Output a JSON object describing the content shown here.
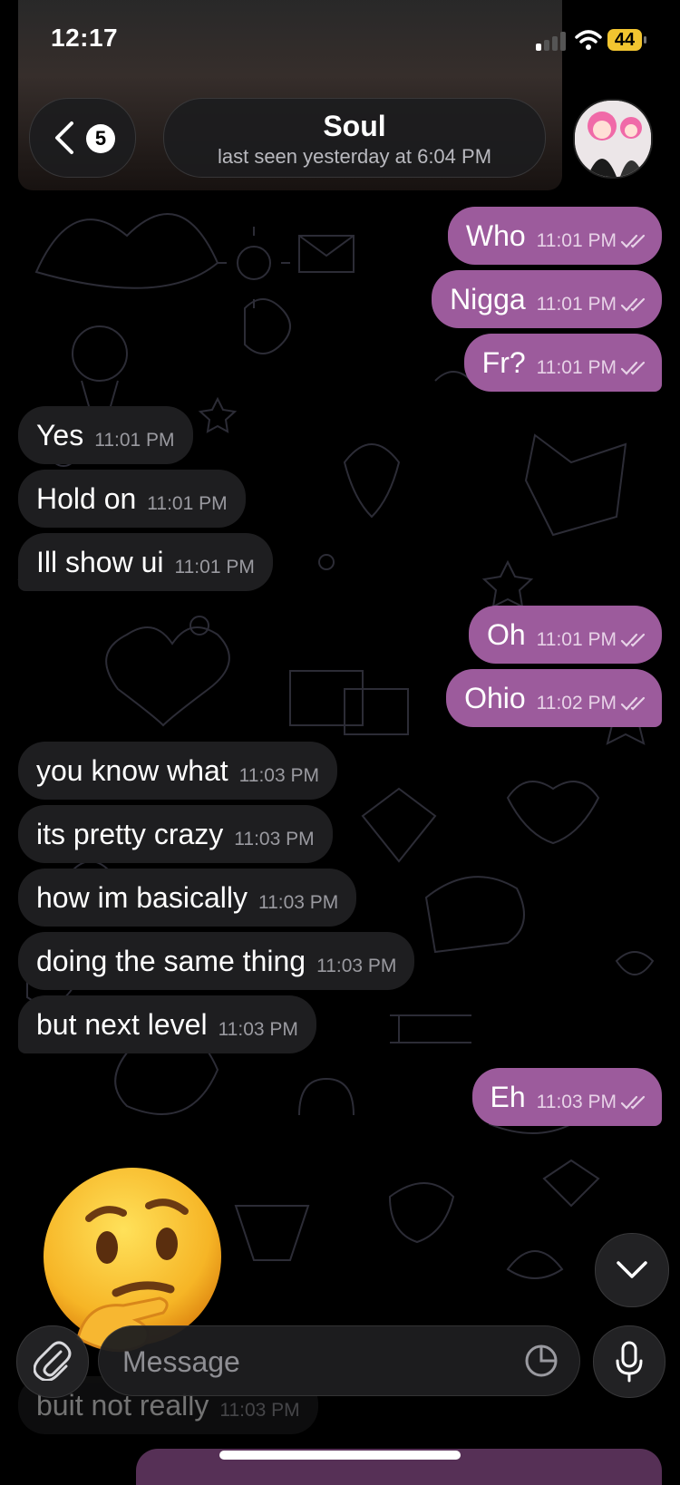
{
  "status_bar": {
    "time": "12:17",
    "battery": "44"
  },
  "header": {
    "back_badge": "5",
    "contact_name": "Soul",
    "last_seen": "last seen yesterday at 6:04 PM"
  },
  "messages": [
    {
      "dir": "out",
      "text": "Who",
      "time": "11:01 PM"
    },
    {
      "dir": "out",
      "text": "Nigga",
      "time": "11:01 PM"
    },
    {
      "dir": "out",
      "text": "Fr?",
      "time": "11:01 PM"
    },
    {
      "dir": "in",
      "text": "Yes",
      "time": "11:01 PM"
    },
    {
      "dir": "in",
      "text": "Hold on",
      "time": "11:01 PM"
    },
    {
      "dir": "in",
      "text": "Ill show ui",
      "time": "11:01 PM"
    },
    {
      "dir": "out",
      "text": "Oh",
      "time": "11:01 PM"
    },
    {
      "dir": "out",
      "text": "Ohio",
      "time": "11:02 PM"
    },
    {
      "dir": "in",
      "text": "you know what",
      "time": "11:03 PM"
    },
    {
      "dir": "in",
      "text": "its pretty crazy",
      "time": "11:03 PM"
    },
    {
      "dir": "in",
      "text": "how im basically",
      "time": "11:03 PM"
    },
    {
      "dir": "in",
      "text": "doing the same thing",
      "time": "11:03 PM"
    },
    {
      "dir": "in",
      "text": "but next level",
      "time": "11:03 PM"
    },
    {
      "dir": "out",
      "text": "Eh",
      "time": "11:03 PM"
    },
    {
      "dir": "in",
      "text": "buit not really",
      "time": "11:03 PM"
    }
  ],
  "emoji": "thinking-face",
  "composer": {
    "placeholder": "Message"
  },
  "colors": {
    "outgoing": "#9c5b9c",
    "incoming": "#1e1e20",
    "background": "#000000"
  }
}
